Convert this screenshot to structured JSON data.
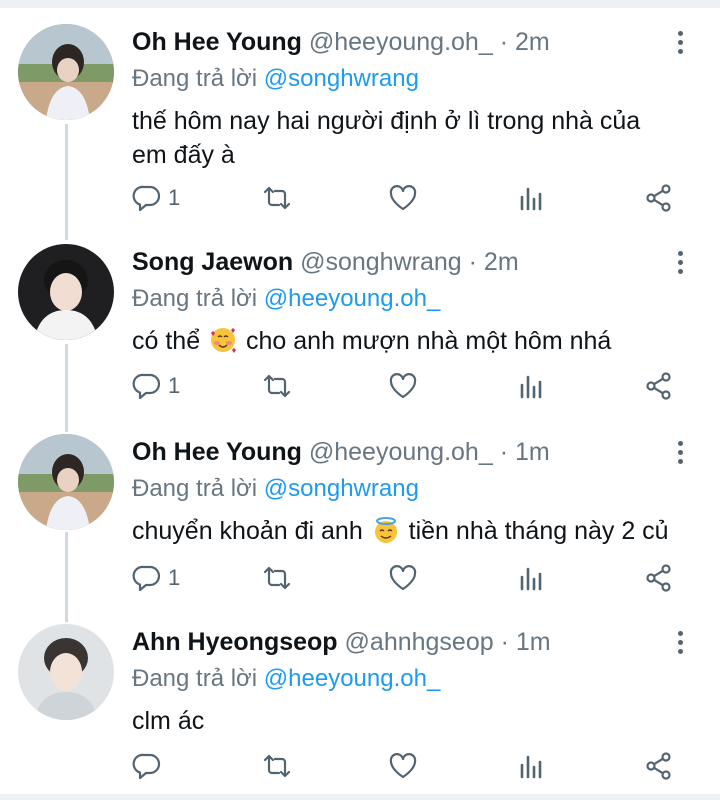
{
  "reply_prefix": "Đang trả lời",
  "tweets": [
    {
      "name": "Oh Hee Young",
      "handle": "@heeyoung.oh_",
      "time": "· 2m",
      "reply_to": "@songhwrang",
      "text_line1": "thế hôm nay hai người định ở lì trong nhà của",
      "text_line2": "em đấy à",
      "reply_count": "1"
    },
    {
      "name": "Song Jaewon",
      "handle": "@songhwrang",
      "time": "· 2m",
      "reply_to": "@heeyoung.oh_",
      "text_before": "có thể",
      "text_after": "cho anh mượn nhà một hôm nhá",
      "emoji": "smiling-face-with-hearts",
      "reply_count": "1"
    },
    {
      "name": "Oh Hee Young",
      "handle": "@heeyoung.oh_",
      "time": "· 1m",
      "reply_to": "@songhwrang",
      "text_before": "chuyển khoản đi anh",
      "text_after": "tiền nhà tháng này 2 củ",
      "emoji": "smiling-face-with-halo",
      "reply_count": "1"
    },
    {
      "name": "Ahn Hyeongseop",
      "handle": "@ahnhgseop",
      "time": "· 1m",
      "reply_to": "@heeyoung.oh_",
      "text": "clm ác",
      "reply_count": ""
    }
  ],
  "colors": {
    "text": "#0f1419",
    "secondary": "#687681",
    "link": "#1d9bf0",
    "icon": "#536471",
    "thread_line": "#cfd9de"
  },
  "icons": [
    "reply-icon",
    "retweet-icon",
    "like-icon",
    "views-icon",
    "share-icon",
    "more-icon"
  ]
}
